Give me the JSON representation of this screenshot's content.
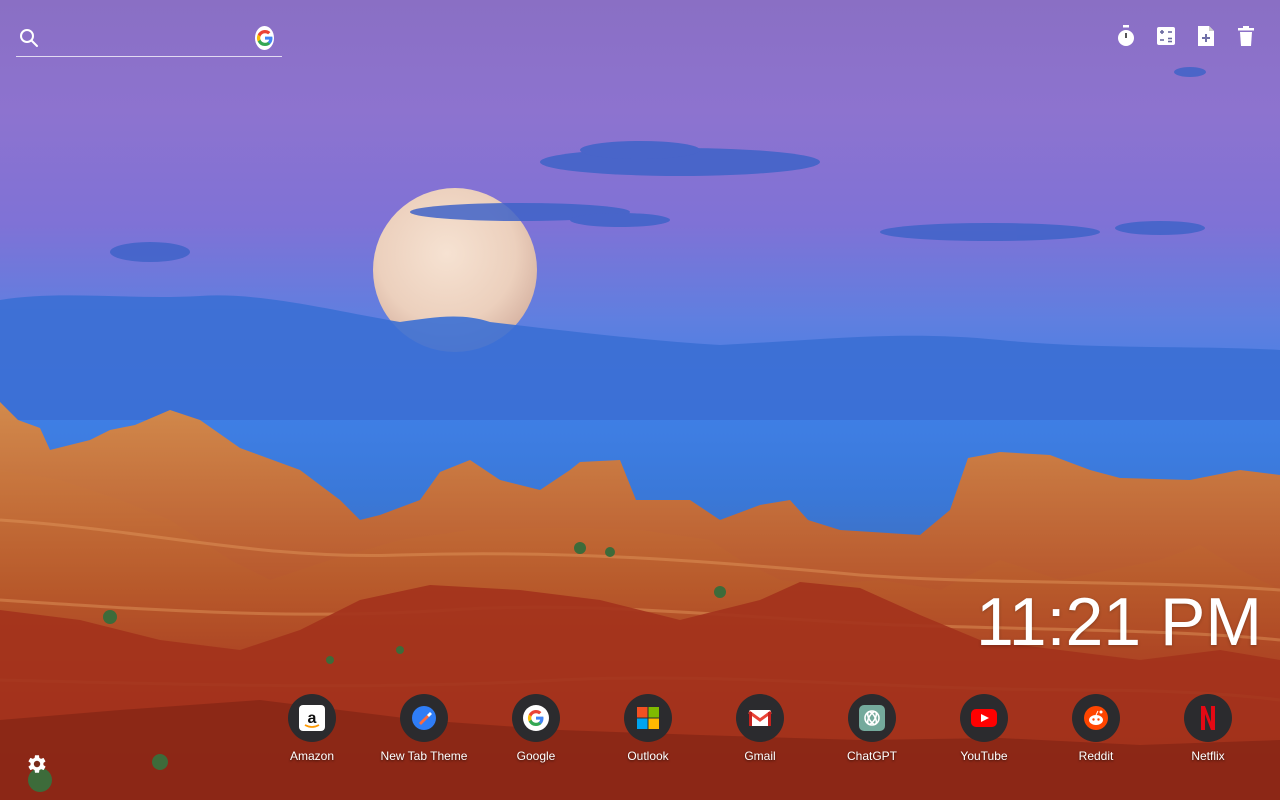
{
  "search": {
    "value": "",
    "placeholder": "",
    "engine_icon": "google-g-icon"
  },
  "toolbar": {
    "icons": [
      "stopwatch-icon",
      "calculator-icon",
      "add-document-icon",
      "trash-icon"
    ]
  },
  "clock": {
    "time": "11:21 PM"
  },
  "shortcuts": [
    {
      "label": "Amazon",
      "icon": "amazon-icon"
    },
    {
      "label": "New Tab Theme",
      "icon": "new-tab-theme-icon"
    },
    {
      "label": "Google",
      "icon": "google-icon"
    },
    {
      "label": "Outlook",
      "icon": "microsoft-icon"
    },
    {
      "label": "Gmail",
      "icon": "gmail-icon"
    },
    {
      "label": "ChatGPT",
      "icon": "chatgpt-icon"
    },
    {
      "label": "YouTube",
      "icon": "youtube-icon"
    },
    {
      "label": "Reddit",
      "icon": "reddit-icon"
    },
    {
      "label": "Netflix",
      "icon": "netflix-icon"
    }
  ],
  "settings": {
    "icon": "gear-icon"
  },
  "background": {
    "scene": "moonrise over badlands canyon",
    "colors": {
      "sky_top": "#8a6fc4",
      "sky_bottom": "#3a78d8",
      "rock": "#b4532a",
      "moon": "#f1d6c2"
    }
  }
}
